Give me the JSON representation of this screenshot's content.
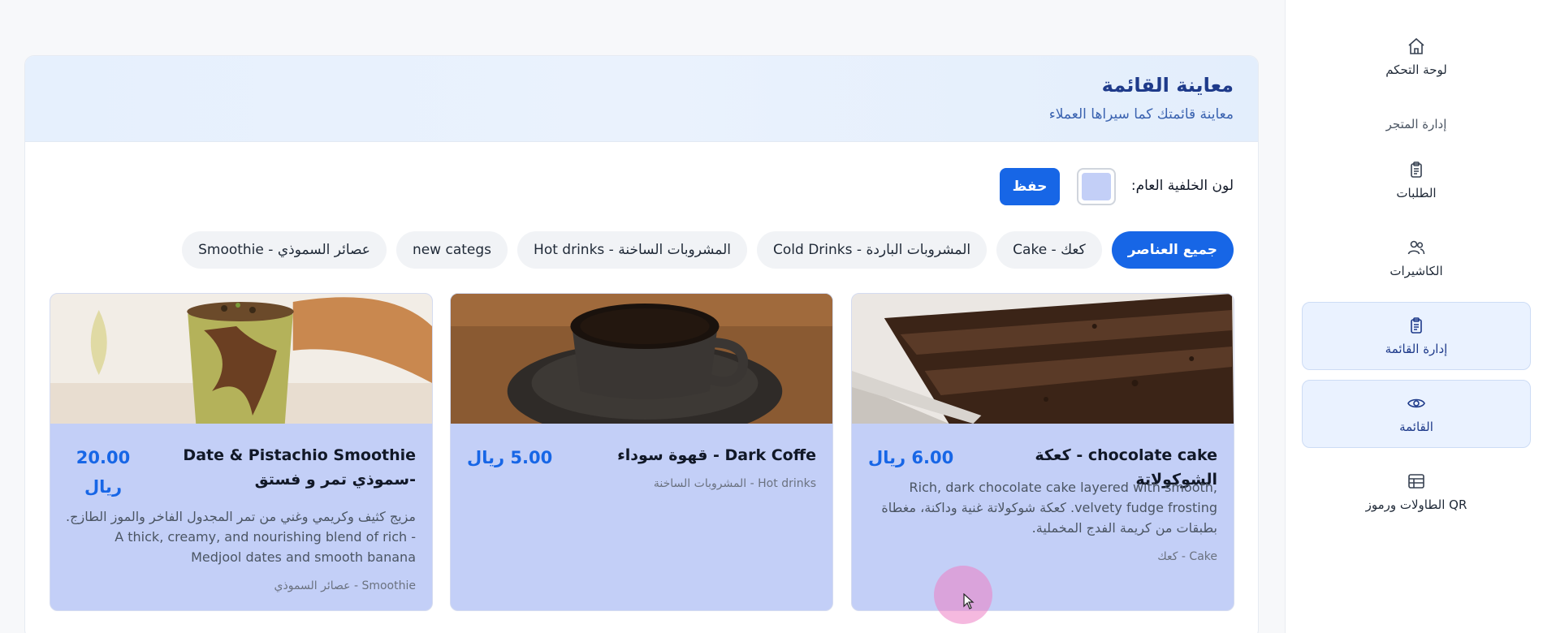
{
  "sidebar": {
    "dashboard_label": "لوحة التحكم",
    "store_section_label": "إدارة المتجر",
    "orders_label": "الطلبات",
    "cashiers_label": "الكاشيرات",
    "menu_manage_label": "إدارة القائمة",
    "menu_label": "القائمة",
    "tables_label": "الطاولات ورموز QR"
  },
  "header": {
    "title": "معاينة القائمة",
    "subtitle": "معاينة قائمتك كما سيراها العملاء"
  },
  "settings": {
    "bg_label": "لون الخلفية العام:",
    "bg_color": "#c3cff7",
    "save_label": "حفظ"
  },
  "categories": [
    {
      "label": "جميع العناصر",
      "active": true
    },
    {
      "label": "Cake - كعك",
      "active": false
    },
    {
      "label": "Cold Drinks - المشروبات الباردة",
      "active": false
    },
    {
      "label": "Hot drinks - المشروبات الساخنة",
      "active": false
    },
    {
      "label": "new categs",
      "active": false
    },
    {
      "label": "Smoothie - عصائر السموذي",
      "active": false
    }
  ],
  "items": [
    {
      "name": "chocolate cake - كعكة الشوكولاتة",
      "price": "6.00 ريال",
      "description": "Rich, dark chocolate cake layered with smooth, velvety fudge frosting. كعكة شوكولاتة غنية وداكنة، مغطاة بطبقات من كريمة الفدج المخملية.",
      "category": "Cake - كعك"
    },
    {
      "name": "Dark Coffe - قهوة سوداء",
      "price": "5.00 ريال",
      "description": "",
      "category": "Hot drinks - المشروبات الساخنة"
    },
    {
      "name": "Date & Pistachio Smoothie -سموذي تمر و فستق",
      "price": "20.00 ريال",
      "description": "مزيج كثيف وكريمي وغني من تمر المجدول الفاخر والموز الطازج. - A thick, creamy, and nourishing blend of rich Medjool dates and smooth banana",
      "category": "Smoothie - عصائر السموذي"
    }
  ]
}
